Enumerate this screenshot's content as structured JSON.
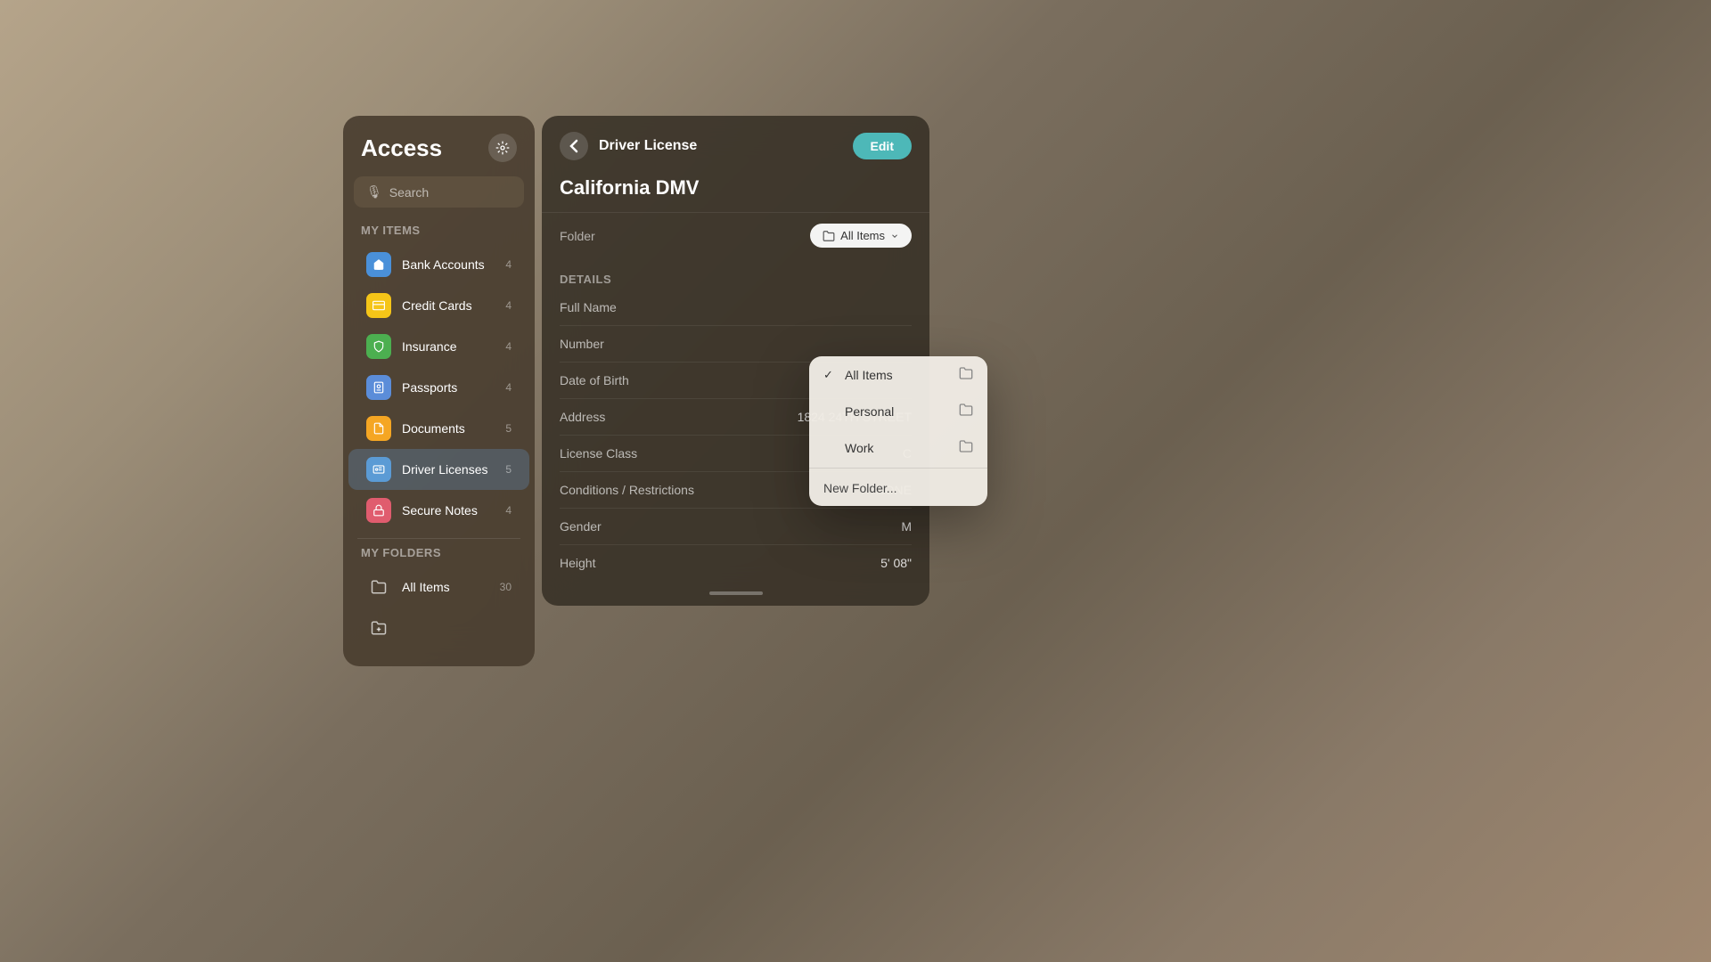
{
  "app": {
    "title": "Access",
    "settings_icon": "⚙",
    "back_icon": "‹"
  },
  "search": {
    "placeholder": "Search",
    "icon": "🎙"
  },
  "my_items": {
    "section_label": "My Items",
    "items": [
      {
        "id": "bank-accounts",
        "label": "Bank Accounts",
        "count": 4,
        "icon_bg": "#4a90d9",
        "icon": "🏦"
      },
      {
        "id": "credit-cards",
        "label": "Credit Cards",
        "count": 4,
        "icon_bg": "#f5c518",
        "icon": "💳"
      },
      {
        "id": "insurance",
        "label": "Insurance",
        "count": 4,
        "icon_bg": "#4caf50",
        "icon": "🛡"
      },
      {
        "id": "passports",
        "label": "Passports",
        "count": 4,
        "icon_bg": "#5b8dd9",
        "icon": "📘"
      },
      {
        "id": "documents",
        "label": "Documents",
        "count": 5,
        "icon_bg": "#f5a623",
        "icon": "📄"
      },
      {
        "id": "driver-licenses",
        "label": "Driver Licenses",
        "count": 5,
        "icon_bg": "#5b9bd5",
        "icon": "🪪",
        "active": true
      },
      {
        "id": "secure-notes",
        "label": "Secure Notes",
        "count": 4,
        "icon_bg": "#e05c6e",
        "icon": "🔒"
      }
    ]
  },
  "my_folders": {
    "section_label": "My Folders",
    "items": [
      {
        "id": "all-items",
        "label": "All Items",
        "count": 30
      }
    ]
  },
  "detail_panel": {
    "title": "Driver License",
    "record_name": "California DMV",
    "folder_label": "Folder",
    "folder_selected": "All Items",
    "edit_label": "Edit",
    "details_section_label": "Details",
    "fields": [
      {
        "key": "Full Name",
        "value": ""
      },
      {
        "key": "Number",
        "value": ""
      },
      {
        "key": "Date of Birth",
        "value": ""
      },
      {
        "key": "Address",
        "value": "1824 24TH STREET"
      },
      {
        "key": "License Class",
        "value": "C"
      },
      {
        "key": "Conditions / Restrictions",
        "value": "NONE"
      },
      {
        "key": "Gender",
        "value": "M"
      },
      {
        "key": "Height",
        "value": "5' 08\""
      }
    ]
  },
  "folder_dropdown": {
    "items": [
      {
        "id": "all-items",
        "label": "All Items",
        "selected": true
      },
      {
        "id": "personal",
        "label": "Personal",
        "selected": false
      },
      {
        "id": "work",
        "label": "Work",
        "selected": false
      }
    ],
    "new_folder_label": "New Folder..."
  }
}
